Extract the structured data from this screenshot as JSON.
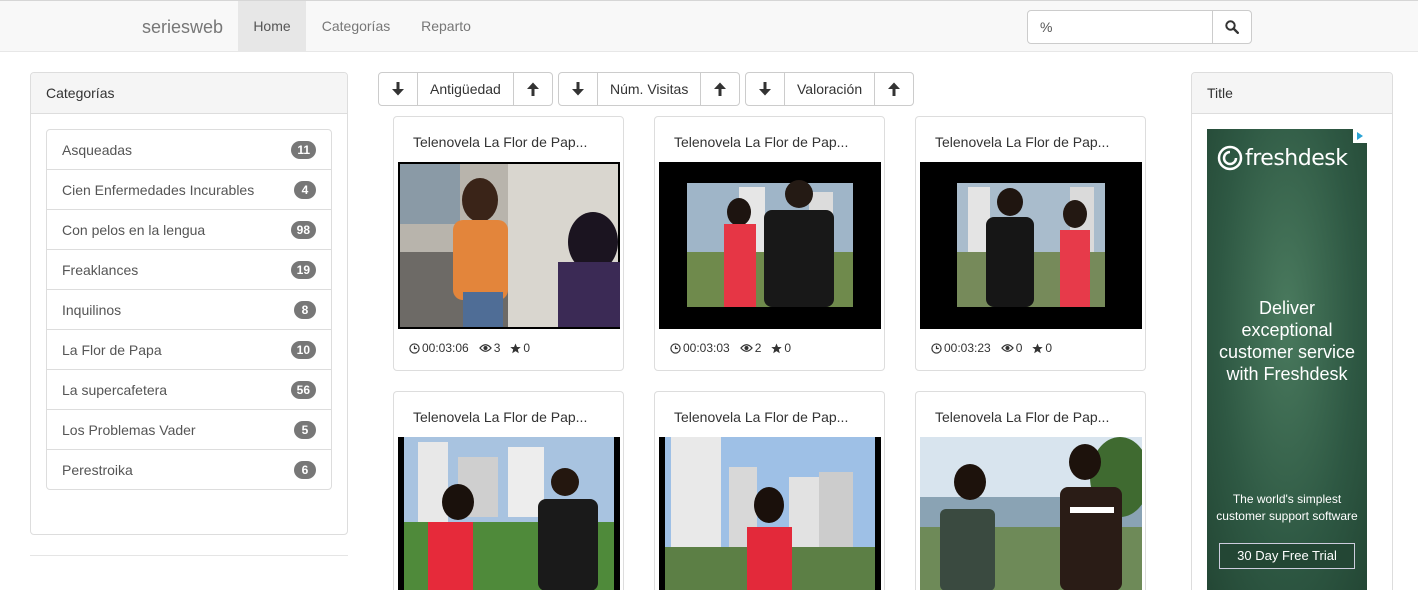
{
  "navbar": {
    "brand_prefix": "series",
    "brand_suffix": "web",
    "items": [
      {
        "label": "Home",
        "active": true
      },
      {
        "label": "Categorías",
        "active": false
      },
      {
        "label": "Reparto",
        "active": false
      }
    ],
    "search_value": "%",
    "search_icon": "search-icon"
  },
  "sidebar": {
    "title": "Categorías",
    "categories": [
      {
        "label": "Asqueadas",
        "count": "11"
      },
      {
        "label": "Cien Enfermedades Incurables",
        "count": "4"
      },
      {
        "label": "Con pelos en la lengua",
        "count": "98"
      },
      {
        "label": "Freaklances",
        "count": "19"
      },
      {
        "label": "Inquilinos",
        "count": "8"
      },
      {
        "label": "La Flor de Papa",
        "count": "10"
      },
      {
        "label": "La supercafetera",
        "count": "56"
      },
      {
        "label": "Los Problemas Vader",
        "count": "5"
      },
      {
        "label": "Perestroika",
        "count": "6"
      }
    ]
  },
  "sort": {
    "groups": [
      {
        "label": "Antigüedad"
      },
      {
        "label": "Núm. Visitas"
      },
      {
        "label": "Valoración"
      }
    ]
  },
  "videos": [
    {
      "title": "Telenovela La Flor de Pap...",
      "duration": "00:03:06",
      "views": "3",
      "rating": "0"
    },
    {
      "title": "Telenovela La Flor de Pap...",
      "duration": "00:03:03",
      "views": "2",
      "rating": "0"
    },
    {
      "title": "Telenovela La Flor de Pap...",
      "duration": "00:03:23",
      "views": "0",
      "rating": "0"
    },
    {
      "title": "Telenovela La Flor de Pap...",
      "duration": "",
      "views": "",
      "rating": ""
    },
    {
      "title": "Telenovela La Flor de Pap...",
      "duration": "",
      "views": "",
      "rating": ""
    },
    {
      "title": "Telenovela La Flor de Pap...",
      "duration": "",
      "views": "",
      "rating": ""
    }
  ],
  "right_panel": {
    "title": "Title",
    "ad": {
      "logo": "freshdesk",
      "headline_1": "Deliver",
      "headline_2": "exceptional",
      "headline_3": "customer service",
      "headline_4": "with Freshdesk",
      "sub_1": "The world's simplest",
      "sub_2": "customer support software",
      "cta": "30 Day Free Trial"
    }
  },
  "colors": {
    "navbar_bg": "#f8f8f8",
    "badge_bg": "#777777",
    "ad_bg": "#2f5a44"
  }
}
